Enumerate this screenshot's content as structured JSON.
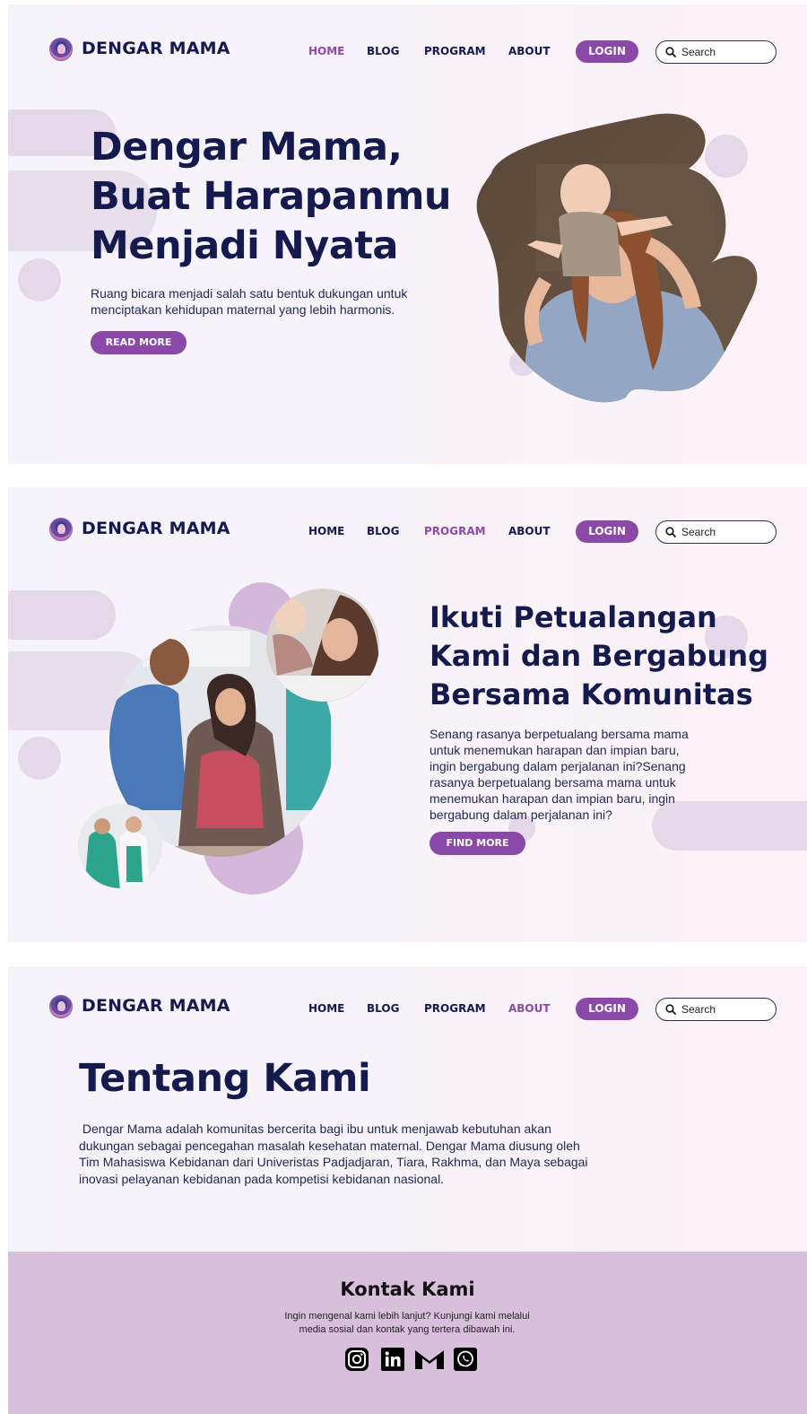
{
  "brand": {
    "name": "DENGAR MAMA"
  },
  "nav": {
    "items": [
      "HOME",
      "BLOG",
      "PROGRAM",
      "ABOUT"
    ],
    "login_label": "LOGIN",
    "search_placeholder": "Search"
  },
  "screens": [
    {
      "active_nav": "HOME"
    },
    {
      "active_nav": "PROGRAM"
    },
    {
      "active_nav": "ABOUT"
    }
  ],
  "hero": {
    "title_lines": [
      "Dengar Mama,",
      "Buat Harapanmu",
      "Menjadi Nyata"
    ],
    "subtitle_lines": [
      "Ruang bicara menjadi salah satu bentuk dukungan untuk",
      "menciptakan kehidupan maternal yang lebih harmonis."
    ],
    "button_label": "READ MORE",
    "image_alt": "mother with baby on shoulders"
  },
  "program": {
    "title_lines": [
      "Ikuti Petualangan",
      "Kami dan Bergabung",
      "Bersama Komunitas"
    ],
    "body_lines": [
      "Senang rasanya berpetualang bersama mama",
      "untuk menemukan harapan dan impian baru,",
      "ingin bergabung dalam perjalanan ini?Senang",
      "rasanya berpetualang bersama mama untuk",
      "menemukan harapan dan impian baru, ingin",
      "bergabung dalam perjalanan ini?"
    ],
    "button_label": "FIND MORE"
  },
  "about": {
    "title": "Tentang Kami",
    "body_lines": [
      " Dengar Mama adalah komunitas bercerita bagi ibu untuk menjawab kebutuhan akan",
      "dukungan sebagai pencegahan masalah kesehatan maternal. Dengar Mama diusung oleh",
      "Tim Mahasiswa Kebidanan dari Univeristas Padjadjaran, Tiara, Rakhma, dan Maya sebagai",
      "inovasi pelayanan kebidanan pada kompetisi kebidanan nasional."
    ]
  },
  "contact": {
    "title": "Kontak Kami",
    "text_lines": [
      "Ingin mengenal kami lebih lanjut? Kunjungi kami melalui",
      "media sosial dan kontak yang tertera dibawah ini."
    ],
    "icons": [
      "instagram-icon",
      "linkedin-icon",
      "gmail-icon",
      "whatsapp-icon"
    ]
  },
  "colors": {
    "navy": "#141a4e",
    "purple": "#8a48a8",
    "lilac": "#e5d8e8",
    "footer": "#d8bfdc"
  }
}
